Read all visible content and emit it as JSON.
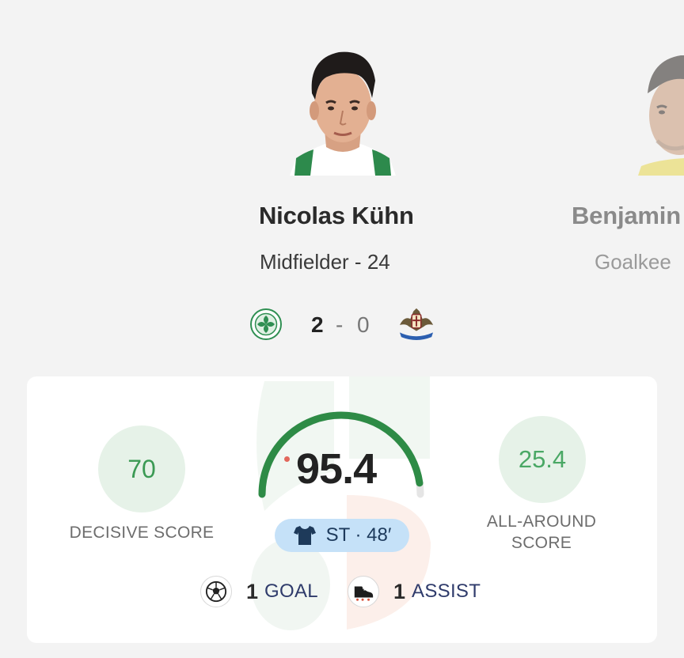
{
  "players": [
    {
      "name": "Nicolas Kühn",
      "position_age": "Midfielder - 24"
    },
    {
      "name": "Benjamin",
      "position_age": "Goalkee"
    }
  ],
  "match": {
    "home_score": "2",
    "separator": "-",
    "away_score": "0",
    "home_crest_icon": "celtic-crest-icon",
    "away_crest_icon": "st-johnstone-crest-icon"
  },
  "card": {
    "decisive_score": {
      "value": "70",
      "label": "DECISIVE SCORE"
    },
    "rating": {
      "value": "95.4",
      "gauge_fraction": 0.954,
      "color": "#2e8b46"
    },
    "position_pill": {
      "text": "ST · 48′",
      "icon": "shirt-icon"
    },
    "all_around_score": {
      "value": "25.4",
      "label_line1": "ALL-AROUND",
      "label_line2": "SCORE"
    },
    "events": [
      {
        "count": "1",
        "label": "GOAL",
        "icon": "football-icon"
      },
      {
        "count": "1",
        "label": "ASSIST",
        "icon": "boot-icon"
      }
    ]
  },
  "colors": {
    "accent_green": "#2e8b46",
    "pill_blue": "#c5e1f8",
    "page_bg": "#f3f3f3"
  }
}
